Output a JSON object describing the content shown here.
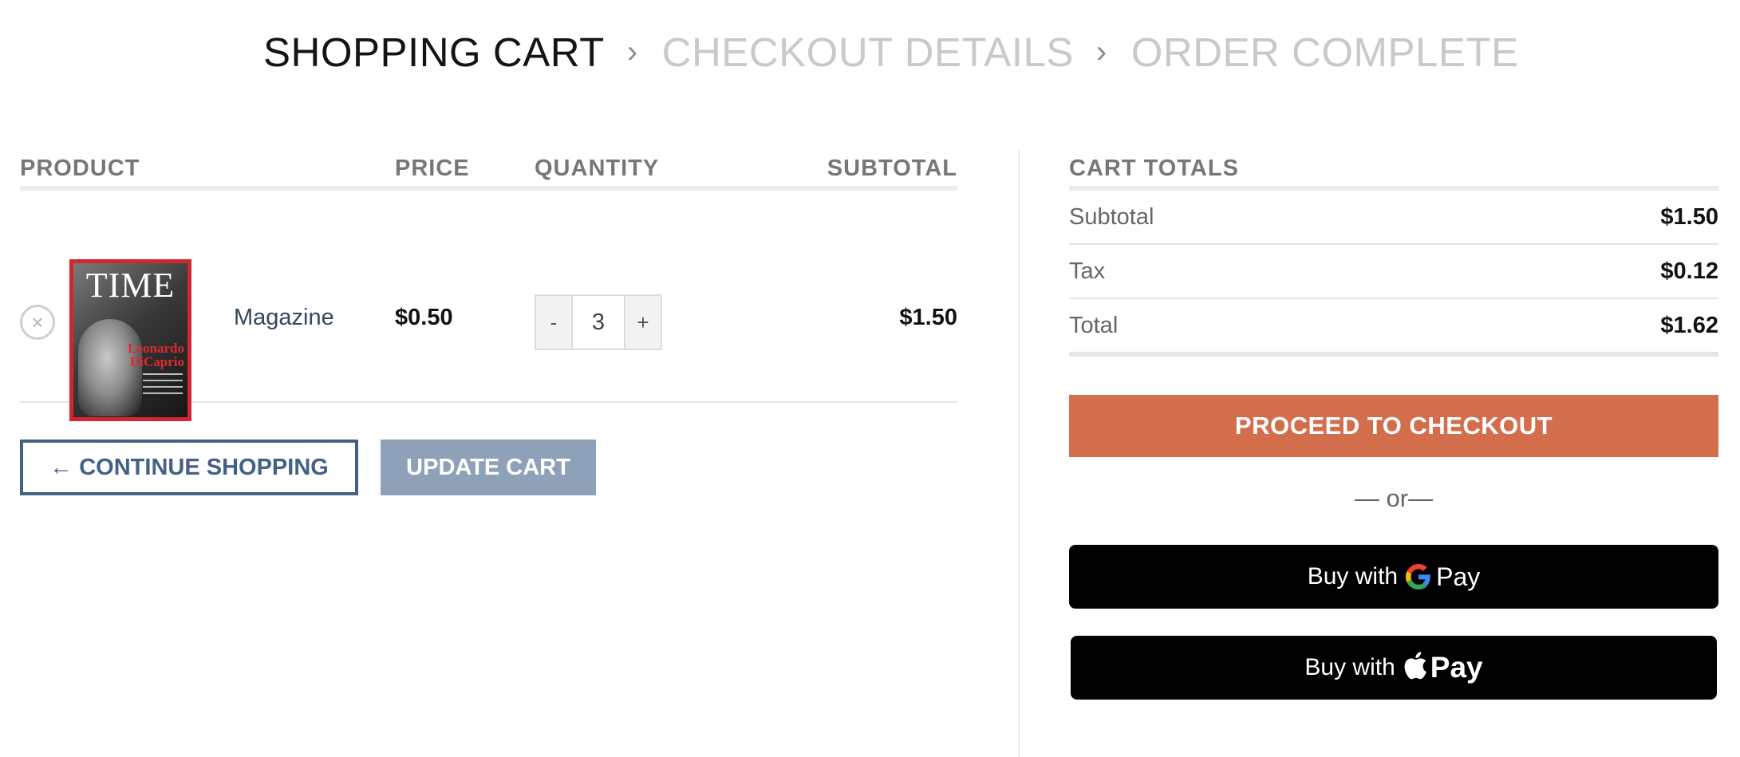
{
  "steps": {
    "items": [
      "SHOPPING CART",
      "CHECKOUT DETAILS",
      "ORDER COMPLETE"
    ],
    "active_index": 0,
    "separator_icon": "chevron-right-icon"
  },
  "cart": {
    "columns": {
      "product": "PRODUCT",
      "price": "PRICE",
      "quantity": "QUANTITY",
      "subtotal": "SUBTOTAL"
    },
    "items": [
      {
        "thumbnail_text": "TIME",
        "thumbnail_cover_name": "Leonardo DiCaprio",
        "name": "Magazine",
        "price": "$0.50",
        "quantity": "3",
        "subtotal": "$1.50",
        "remove_icon": "×"
      }
    ],
    "qty_minus": "-",
    "qty_plus": "+",
    "continue_label": "← CONTINUE SHOPPING",
    "update_label": "UPDATE CART"
  },
  "totals": {
    "title": "CART TOTALS",
    "rows": [
      {
        "label": "Subtotal",
        "value": "$1.50"
      },
      {
        "label": "Tax",
        "value": "$0.12"
      },
      {
        "label": "Total",
        "value": "$1.62"
      }
    ],
    "checkout_label": "PROCEED TO CHECKOUT",
    "or_text": "— or—",
    "gpay_prefix": "Buy with",
    "gpay_word": "Pay",
    "applepay_prefix": "Buy with",
    "applepay_word": "Pay"
  },
  "colors": {
    "accent_checkout": "#d26e4b",
    "primary_link": "#446084",
    "update_button": "#8fa1b8"
  }
}
